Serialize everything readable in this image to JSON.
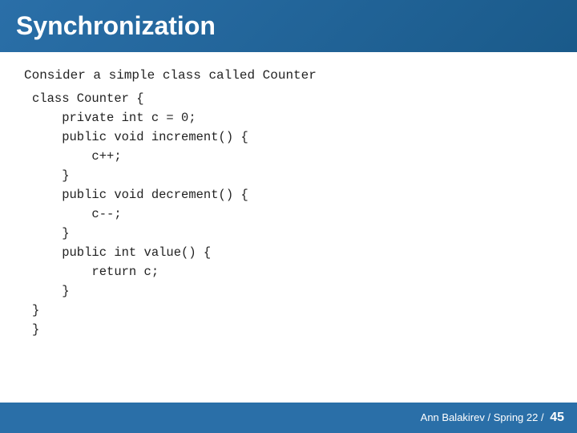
{
  "header": {
    "title": "Synchronization",
    "bg_color": "#2a6fa8"
  },
  "content": {
    "intro": "Consider a simple class called Counter",
    "code_lines": [
      "class Counter {",
      "    private int c = 0;",
      "    public void increment() {",
      "        c++;",
      "    }",
      "    public void decrement() {",
      "        c--;",
      "    }",
      "    public int value() {",
      "        return c;",
      "    }",
      "}"
    ],
    "closing_brace": "}"
  },
  "footer": {
    "slide_info": "Ann Balakirev / Spring 22 /",
    "page_number": "45"
  }
}
